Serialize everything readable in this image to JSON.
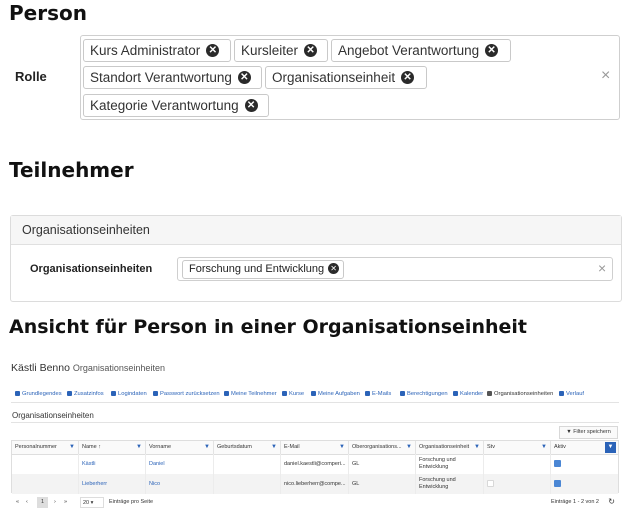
{
  "headings": {
    "person": "Person",
    "teilnehmer": "Teilnehmer",
    "ansicht": "Ansicht für Person in einer Organisationseinheit"
  },
  "rolle": {
    "label": "Rolle",
    "chips": [
      "Kurs Administrator",
      "Kursleiter",
      "Angebot Verantwortung",
      "Standort Verantwortung",
      "Organisationseinheit",
      "Kategorie Verantwortung"
    ],
    "remove_glyph": "✕",
    "clear_glyph": "×"
  },
  "teilnehmer_panel": {
    "title": "Organisationseinheiten",
    "field_label": "Organisationseinheiten",
    "chip": "Forschung und Entwicklung",
    "clear_glyph": "×"
  },
  "screenshot": {
    "person_name": "Kästli Benno",
    "person_sub": "Organisationseinheiten",
    "tabs": [
      {
        "label": "Grundlegendes",
        "icon": "person-icon"
      },
      {
        "label": "Zusatzinfos",
        "icon": "info-icon"
      },
      {
        "label": "Logindaten",
        "icon": "lock-icon"
      },
      {
        "label": "Passwort zurücksetzen",
        "icon": "key-icon"
      },
      {
        "label": "Meine Teilnehmer",
        "icon": "users-icon"
      },
      {
        "label": "Kurse",
        "icon": "list-icon"
      },
      {
        "label": "Meine Aufgaben",
        "icon": "check-icon"
      },
      {
        "label": "E-Mails",
        "icon": "mail-icon"
      },
      {
        "label": "Berechtigungen",
        "icon": "shield-icon"
      },
      {
        "label": "Kalender",
        "icon": "calendar-icon"
      },
      {
        "label": "Organisationseinheiten",
        "icon": "briefcase-icon",
        "active": true
      },
      {
        "label": "Verlauf",
        "icon": "history-icon"
      }
    ],
    "section_title": "Organisationseinheiten",
    "filter_button": "Filter speichern",
    "columns": [
      "Personalnummer",
      "Name ↑",
      "Vorname",
      "Geburtsdatum",
      "E-Mail",
      "Oberorganisations...",
      "Organisationseinheit",
      "Stv",
      "Aktiv"
    ],
    "rows": [
      {
        "personalnummer": "",
        "name": "Kästli",
        "vorname": "Daniel",
        "geburtsdatum": "",
        "email": "daniel.kaestli@comperi...",
        "ober": "GL",
        "org": "Forschung und Entwicklung",
        "stv": false,
        "aktiv": true
      },
      {
        "personalnummer": "",
        "name": "Lieberherr",
        "vorname": "Nico",
        "geburtsdatum": "",
        "email": "nico.lieberherr@compe...",
        "ober": "GL",
        "org": "Forschung und Entwicklung",
        "stv": false,
        "aktiv": true
      }
    ],
    "pager": {
      "first": "«",
      "prev": "‹",
      "current": "1",
      "next": "›",
      "last": "»",
      "per_page": "20",
      "per_page_label": "Einträge pro Seite",
      "entries": "Einträge 1 - 2 von 2"
    }
  },
  "colors": {
    "link": "#2b63b8",
    "chip_x": "#2a2a2a",
    "checkbox": "#4a86d4"
  }
}
